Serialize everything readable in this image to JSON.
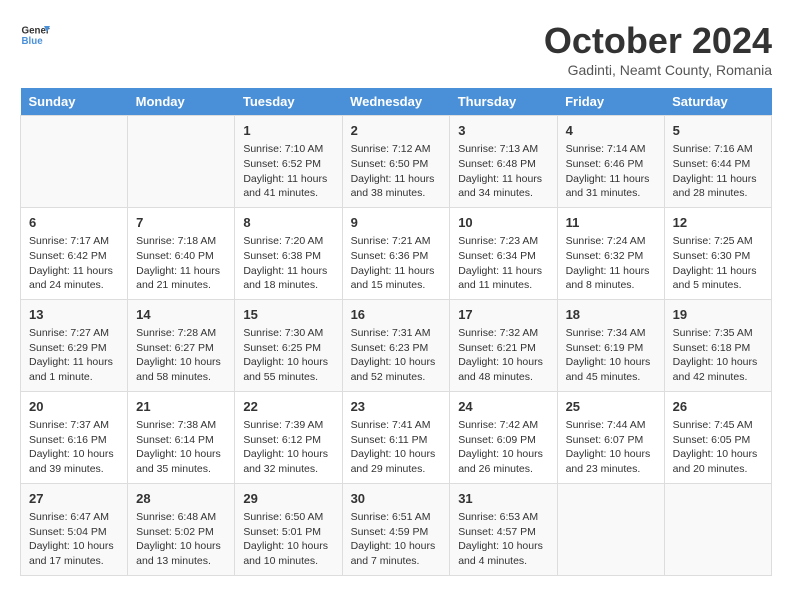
{
  "logo": {
    "general": "General",
    "blue": "Blue"
  },
  "header": {
    "month": "October 2024",
    "location": "Gadinti, Neamt County, Romania"
  },
  "weekdays": [
    "Sunday",
    "Monday",
    "Tuesday",
    "Wednesday",
    "Thursday",
    "Friday",
    "Saturday"
  ],
  "weeks": [
    [
      null,
      null,
      {
        "day": 1,
        "sunrise": "7:10 AM",
        "sunset": "6:52 PM",
        "daylight": "11 hours and 41 minutes."
      },
      {
        "day": 2,
        "sunrise": "7:12 AM",
        "sunset": "6:50 PM",
        "daylight": "11 hours and 38 minutes."
      },
      {
        "day": 3,
        "sunrise": "7:13 AM",
        "sunset": "6:48 PM",
        "daylight": "11 hours and 34 minutes."
      },
      {
        "day": 4,
        "sunrise": "7:14 AM",
        "sunset": "6:46 PM",
        "daylight": "11 hours and 31 minutes."
      },
      {
        "day": 5,
        "sunrise": "7:16 AM",
        "sunset": "6:44 PM",
        "daylight": "11 hours and 28 minutes."
      }
    ],
    [
      {
        "day": 6,
        "sunrise": "7:17 AM",
        "sunset": "6:42 PM",
        "daylight": "11 hours and 24 minutes."
      },
      {
        "day": 7,
        "sunrise": "7:18 AM",
        "sunset": "6:40 PM",
        "daylight": "11 hours and 21 minutes."
      },
      {
        "day": 8,
        "sunrise": "7:20 AM",
        "sunset": "6:38 PM",
        "daylight": "11 hours and 18 minutes."
      },
      {
        "day": 9,
        "sunrise": "7:21 AM",
        "sunset": "6:36 PM",
        "daylight": "11 hours and 15 minutes."
      },
      {
        "day": 10,
        "sunrise": "7:23 AM",
        "sunset": "6:34 PM",
        "daylight": "11 hours and 11 minutes."
      },
      {
        "day": 11,
        "sunrise": "7:24 AM",
        "sunset": "6:32 PM",
        "daylight": "11 hours and 8 minutes."
      },
      {
        "day": 12,
        "sunrise": "7:25 AM",
        "sunset": "6:30 PM",
        "daylight": "11 hours and 5 minutes."
      }
    ],
    [
      {
        "day": 13,
        "sunrise": "7:27 AM",
        "sunset": "6:29 PM",
        "daylight": "11 hours and 1 minute."
      },
      {
        "day": 14,
        "sunrise": "7:28 AM",
        "sunset": "6:27 PM",
        "daylight": "10 hours and 58 minutes."
      },
      {
        "day": 15,
        "sunrise": "7:30 AM",
        "sunset": "6:25 PM",
        "daylight": "10 hours and 55 minutes."
      },
      {
        "day": 16,
        "sunrise": "7:31 AM",
        "sunset": "6:23 PM",
        "daylight": "10 hours and 52 minutes."
      },
      {
        "day": 17,
        "sunrise": "7:32 AM",
        "sunset": "6:21 PM",
        "daylight": "10 hours and 48 minutes."
      },
      {
        "day": 18,
        "sunrise": "7:34 AM",
        "sunset": "6:19 PM",
        "daylight": "10 hours and 45 minutes."
      },
      {
        "day": 19,
        "sunrise": "7:35 AM",
        "sunset": "6:18 PM",
        "daylight": "10 hours and 42 minutes."
      }
    ],
    [
      {
        "day": 20,
        "sunrise": "7:37 AM",
        "sunset": "6:16 PM",
        "daylight": "10 hours and 39 minutes."
      },
      {
        "day": 21,
        "sunrise": "7:38 AM",
        "sunset": "6:14 PM",
        "daylight": "10 hours and 35 minutes."
      },
      {
        "day": 22,
        "sunrise": "7:39 AM",
        "sunset": "6:12 PM",
        "daylight": "10 hours and 32 minutes."
      },
      {
        "day": 23,
        "sunrise": "7:41 AM",
        "sunset": "6:11 PM",
        "daylight": "10 hours and 29 minutes."
      },
      {
        "day": 24,
        "sunrise": "7:42 AM",
        "sunset": "6:09 PM",
        "daylight": "10 hours and 26 minutes."
      },
      {
        "day": 25,
        "sunrise": "7:44 AM",
        "sunset": "6:07 PM",
        "daylight": "10 hours and 23 minutes."
      },
      {
        "day": 26,
        "sunrise": "7:45 AM",
        "sunset": "6:05 PM",
        "daylight": "10 hours and 20 minutes."
      }
    ],
    [
      {
        "day": 27,
        "sunrise": "6:47 AM",
        "sunset": "5:04 PM",
        "daylight": "10 hours and 17 minutes."
      },
      {
        "day": 28,
        "sunrise": "6:48 AM",
        "sunset": "5:02 PM",
        "daylight": "10 hours and 13 minutes."
      },
      {
        "day": 29,
        "sunrise": "6:50 AM",
        "sunset": "5:01 PM",
        "daylight": "10 hours and 10 minutes."
      },
      {
        "day": 30,
        "sunrise": "6:51 AM",
        "sunset": "4:59 PM",
        "daylight": "10 hours and 7 minutes."
      },
      {
        "day": 31,
        "sunrise": "6:53 AM",
        "sunset": "4:57 PM",
        "daylight": "10 hours and 4 minutes."
      },
      null,
      null
    ]
  ],
  "labels": {
    "sunrise": "Sunrise:",
    "sunset": "Sunset:",
    "daylight": "Daylight:"
  }
}
